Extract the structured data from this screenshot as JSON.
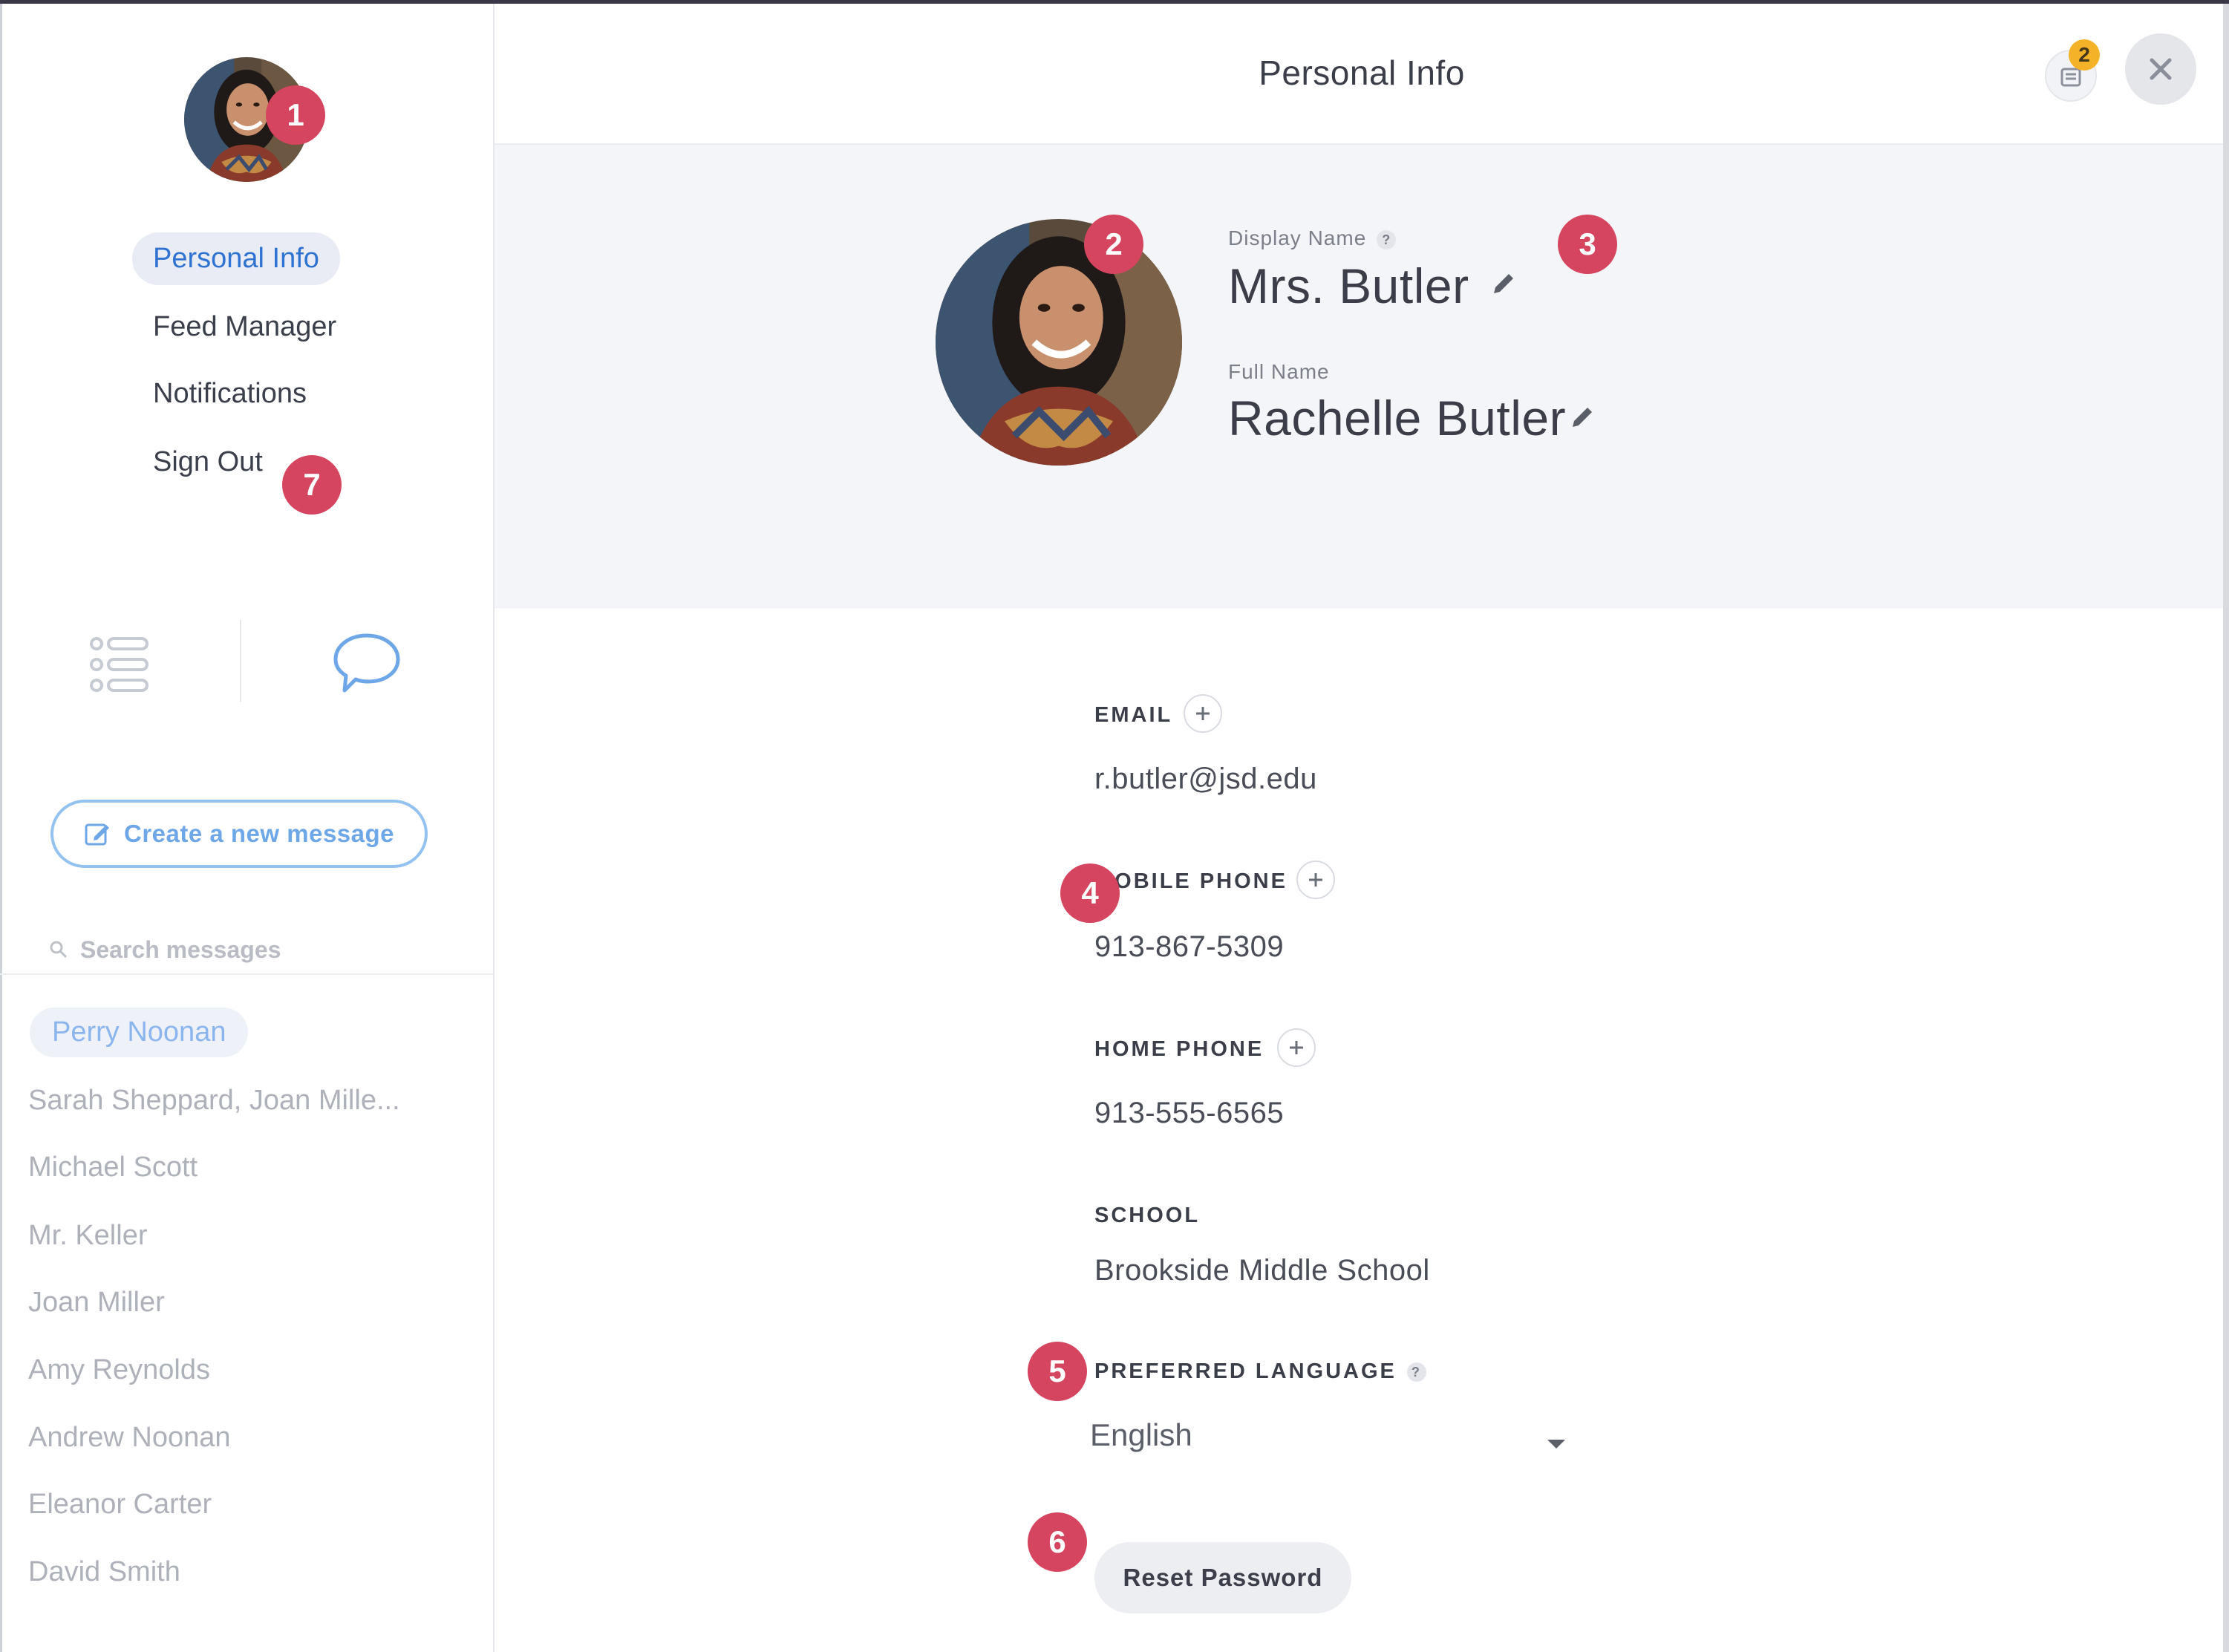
{
  "window": {
    "title": "Personal Info"
  },
  "header": {
    "title": "Personal Info",
    "notification_count": "2"
  },
  "sidebar": {
    "nav": [
      {
        "label": "Personal Info",
        "active": true
      },
      {
        "label": "Feed Manager"
      },
      {
        "label": "Notifications"
      },
      {
        "label": "Sign Out"
      }
    ],
    "create_label": "Create a new message",
    "search_placeholder": "Search messages",
    "conversations": [
      {
        "name": "Perry Noonan",
        "active": true
      },
      {
        "name": "Sarah Sheppard, Joan Mille..."
      },
      {
        "name": "Michael Scott"
      },
      {
        "name": "Mr. Keller"
      },
      {
        "name": "Joan Miller"
      },
      {
        "name": "Amy Reynolds"
      },
      {
        "name": "Andrew Noonan"
      },
      {
        "name": "Eleanor Carter"
      },
      {
        "name": "David Smith"
      }
    ]
  },
  "profile": {
    "display_name_label": "Display Name",
    "display_name": "Mrs. Butler",
    "full_name_label": "Full Name",
    "full_name": "Rachelle Butler"
  },
  "fields": {
    "email_label": "EMAIL",
    "email_value": "r.butler@jsd.edu",
    "mobile_label": "MOBILE PHONE",
    "mobile_value": "913-867-5309",
    "home_label": "HOME PHONE",
    "home_value": "913-555-6565",
    "school_label": "SCHOOL",
    "school_value": "Brookside Middle School",
    "language_label": "PREFERRED LANGUAGE",
    "language_value": "English",
    "reset_label": "Reset Password"
  },
  "callouts": [
    "1",
    "2",
    "3",
    "4",
    "5",
    "6",
    "7"
  ],
  "colors": {
    "accent": "#2e73d1",
    "callout": "#d6455f",
    "notification": "#f4b228",
    "band": "#f4f5f8"
  }
}
